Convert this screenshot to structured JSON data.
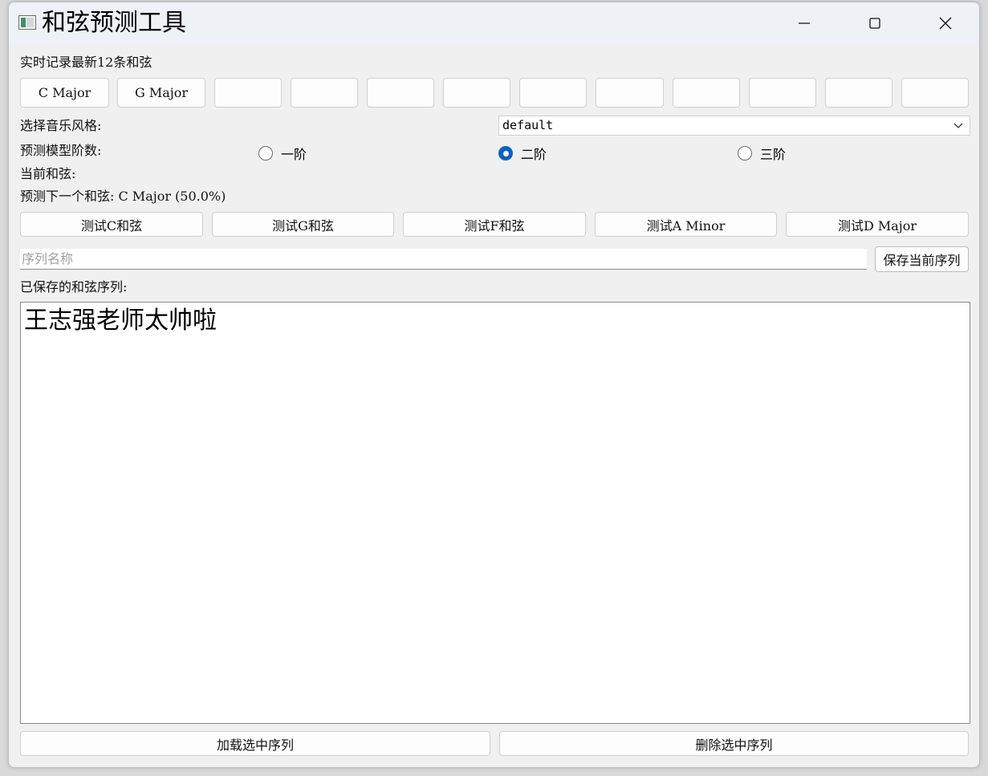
{
  "window": {
    "title": "和弦预测工具",
    "icon": "window-app-icon"
  },
  "recent": {
    "label": "实时记录最新12条和弦",
    "chords": [
      "C Major",
      "G Major",
      "",
      "",
      "",
      "",
      "",
      "",
      "",
      "",
      "",
      ""
    ]
  },
  "style": {
    "label": "选择音乐风格:",
    "selected": "default"
  },
  "order": {
    "label": "预测模型阶数:",
    "options": [
      "一阶",
      "二阶",
      "三阶"
    ],
    "selected": "二阶"
  },
  "current": {
    "label": "当前和弦:"
  },
  "prediction": {
    "text": "预测下一个和弦: C Major (50.0%)"
  },
  "tests": [
    "测试C和弦",
    "测试G和弦",
    "测试F和弦",
    "测试A Minor",
    "测试D Major"
  ],
  "save": {
    "placeholder": "序列名称",
    "button": "保存当前序列"
  },
  "saved": {
    "label": "已保存的和弦序列:",
    "items": [
      "王志强老师太帅啦"
    ]
  },
  "actions": {
    "load": "加载选中序列",
    "delete": "删除选中序列"
  },
  "colors": {
    "accent": "#0a62c2",
    "titlebar": "#eef1f6",
    "window": "#f0f0f0"
  }
}
